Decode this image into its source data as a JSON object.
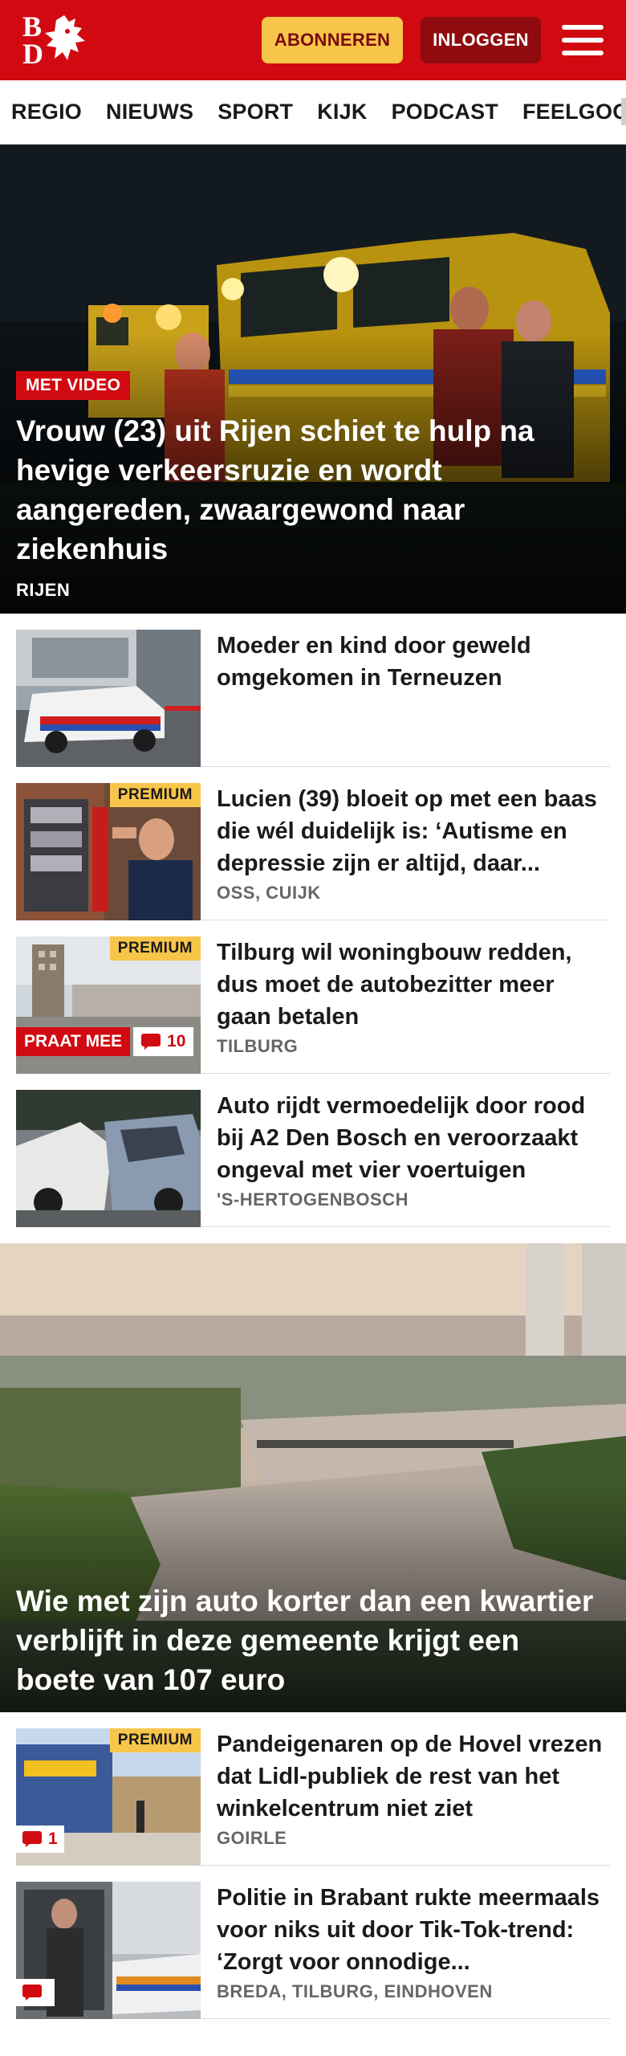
{
  "header": {
    "logo_letters": [
      "B",
      "D"
    ],
    "subscribe_label": "ABONNEREN",
    "login_label": "INLOGGEN",
    "menu_icon": "hamburger-icon",
    "brand_color": "#d10a11",
    "subscribe_color": "#f7c54a"
  },
  "nav": {
    "items": [
      "REGIO",
      "NIEUWS",
      "SPORT",
      "KIJK",
      "PODCAST",
      "FEELGOOD"
    ]
  },
  "hero": {
    "badge": "MET VIDEO",
    "title": "Vrouw (23) uit Rijen schiet te hulp na hevige verkeersruzie en wordt aangereden, zwaargewond naar ziekenhuis",
    "location": "RIJEN"
  },
  "articles": [
    {
      "title": "Moeder en kind door geweld omgekomen in Terneuzen",
      "location": ""
    },
    {
      "premium": "PREMIUM",
      "title": "Lucien (39) bloeit op met een baas die wél duidelijk is: ‘Autisme en depressie zijn er altijd, daar...",
      "location": "OSS, CUIJK"
    },
    {
      "premium": "PREMIUM",
      "praat_mee": "PRAAT MEE",
      "comments": "10",
      "title": "Tilburg wil woningbouw redden, dus moet de autobezitter meer gaan betalen",
      "location": "TILBURG"
    },
    {
      "title": "Auto rijdt vermoedelijk door rood bij A2 Den Bosch en veroorzaakt ongeval met vier voertuigen",
      "location": "'S-HERTOGENBOSCH"
    }
  ],
  "hero2": {
    "title": "Wie met zijn auto korter dan een kwartier verblijft in deze gemeente krijgt een boete van 107 euro"
  },
  "articles2": [
    {
      "premium": "PREMIUM",
      "comments": "1",
      "title": "Pandeigenaren op de Hovel vrezen dat Lidl-publiek de rest van het winkelcentrum niet ziet",
      "location": "GOIRLE"
    },
    {
      "comments": "",
      "title": "Politie in Brabant rukte meermaals voor niks uit door Tik-Tok-trend: ‘Zorgt voor onnodige...",
      "location": "BREDA, TILBURG, EINDHOVEN"
    }
  ]
}
